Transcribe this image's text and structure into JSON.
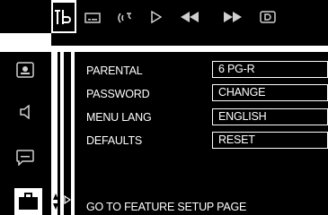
{
  "top_toolbar": {
    "icons": [
      {
        "name": "setup-icon",
        "active": true
      },
      {
        "name": "subtitle-icon"
      },
      {
        "name": "audio-icon"
      },
      {
        "name": "play-icon"
      },
      {
        "name": "rewind-icon"
      },
      {
        "name": "fast-forward-icon"
      },
      {
        "name": "display-icon"
      }
    ]
  },
  "sidebar": {
    "icons": [
      "video-setup-icon",
      "audio-setup-icon",
      "language-setup-icon",
      "feature-setup-icon"
    ],
    "selected": "feature-setup-icon"
  },
  "menu": {
    "rows": [
      {
        "label": "PARENTAL",
        "value": "6 PG-R"
      },
      {
        "label": "PASSWORD",
        "value": "CHANGE"
      },
      {
        "label": "MENU LANG",
        "value": "ENGLISH"
      },
      {
        "label": "DEFAULTS",
        "value": "RESET"
      }
    ]
  },
  "status": {
    "text": "GO TO FEATURE SETUP PAGE"
  },
  "colors": {
    "background": "#000000",
    "foreground": "#ffffff",
    "icon": "#cfcfcf"
  }
}
